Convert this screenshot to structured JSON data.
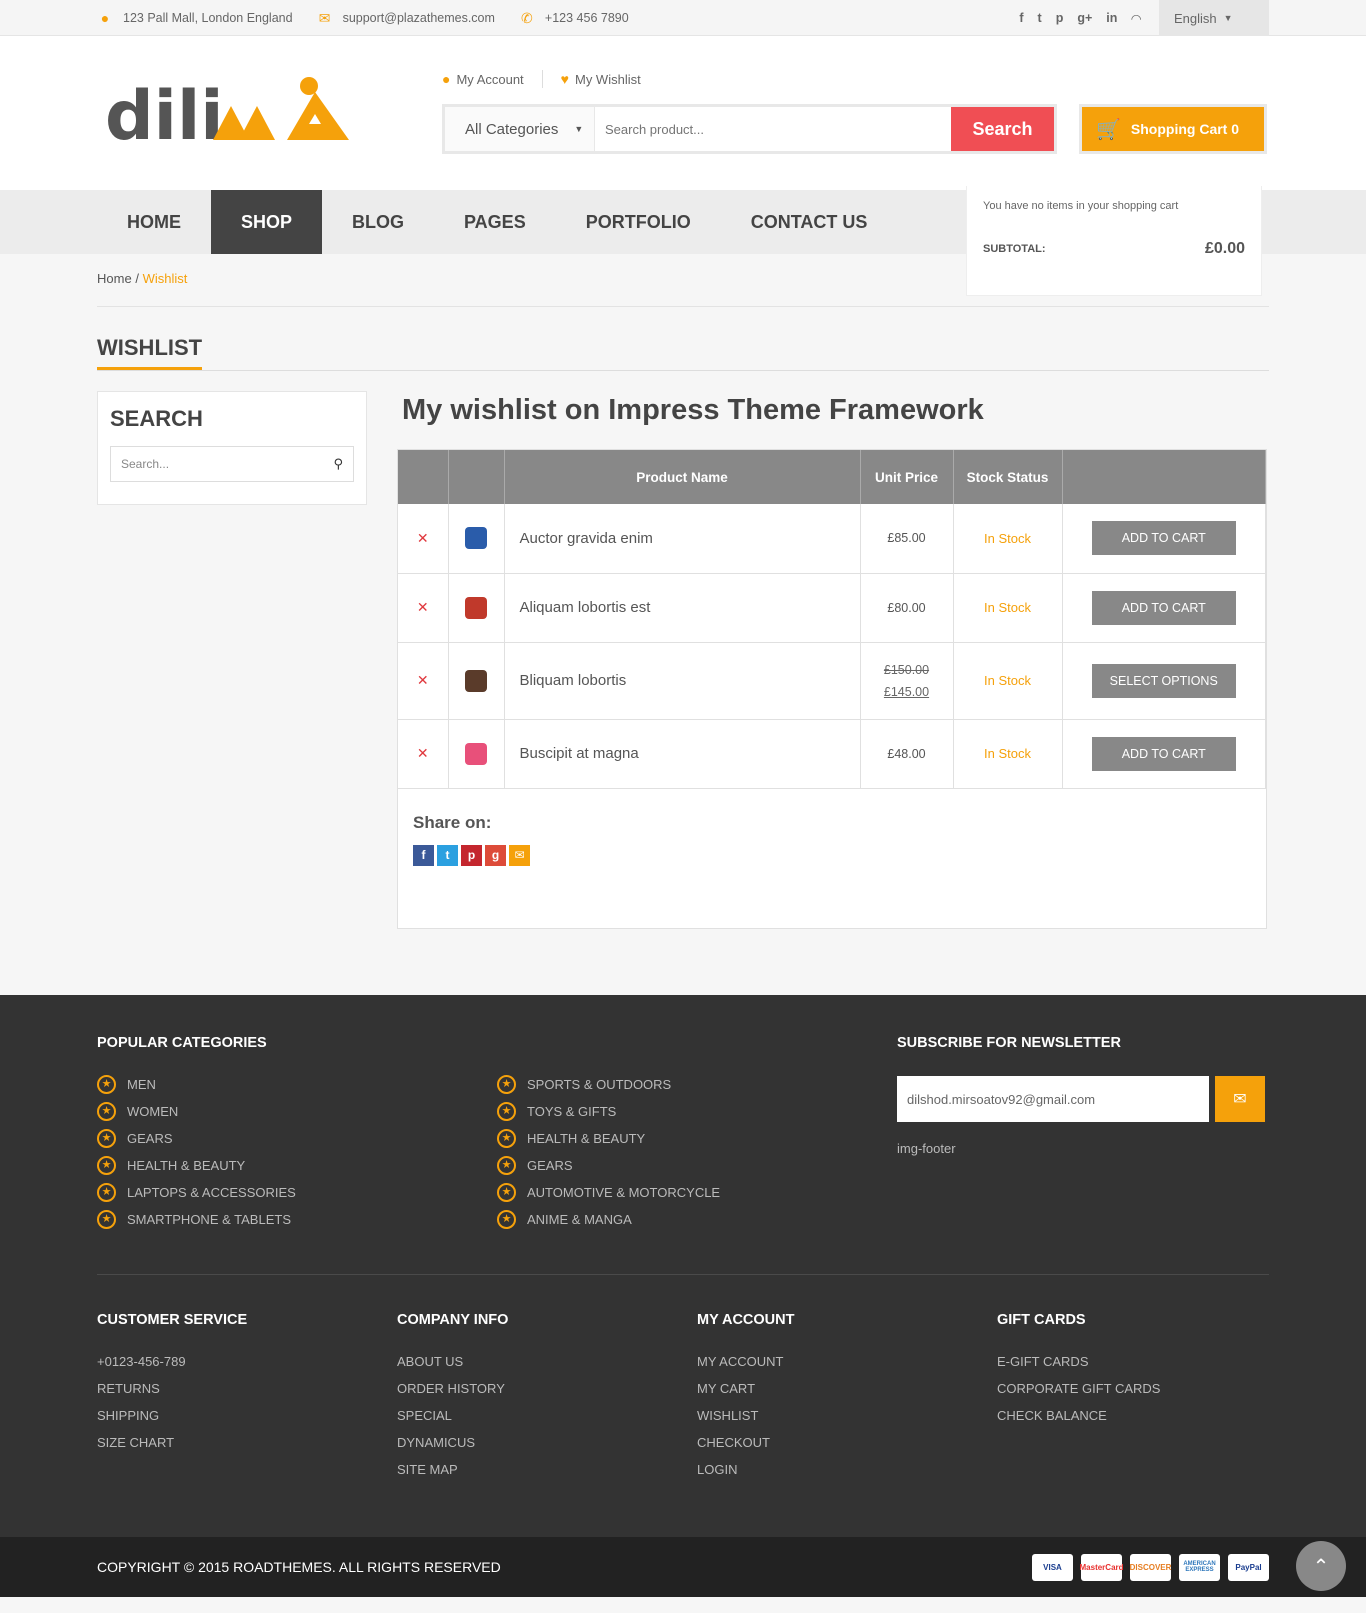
{
  "topbar": {
    "address": "123 Pall Mall, London England",
    "email": "support@plazathemes.com",
    "phone": "+123 456 7890",
    "language": "English"
  },
  "header": {
    "my_account": "My Account",
    "my_wishlist": "My Wishlist",
    "category_select": "All Categories",
    "search_placeholder": "Search product...",
    "search_button": "Search",
    "cart_label": "Shopping Cart 0",
    "cart_empty": "You have no items in your shopping cart",
    "subtotal_label": "SUBTOTAL:",
    "subtotal_value": "£0.00"
  },
  "nav": [
    "HOME",
    "SHOP",
    "BLOG",
    "PAGES",
    "PORTFOLIO",
    "CONTACT US"
  ],
  "breadcrumb": {
    "home": "Home",
    "sep": "/",
    "current": "Wishlist"
  },
  "page_title": "WISHLIST",
  "sidebar": {
    "title": "SEARCH",
    "placeholder": "Search..."
  },
  "wishlist": {
    "title": "My wishlist on Impress Theme Framework",
    "columns": {
      "name": "Product Name",
      "price": "Unit Price",
      "stock": "Stock Status"
    },
    "items": [
      {
        "name": "Auctor gravida enim",
        "price": "£85.00",
        "stock": "In Stock",
        "action": "ADD TO CART",
        "color": "#2a5caa"
      },
      {
        "name": "Aliquam lobortis est",
        "price": "£80.00",
        "stock": "In Stock",
        "action": "ADD TO CART",
        "color": "#c0392b"
      },
      {
        "name": "Bliquam lobortis",
        "old_price": "£150.00",
        "price": "£145.00",
        "stock": "In Stock",
        "action": "SELECT OPTIONS",
        "color": "#5a3b2a"
      },
      {
        "name": "Buscipit at magna",
        "price": "£48.00",
        "stock": "In Stock",
        "action": "ADD TO CART",
        "color": "#e8507a"
      }
    ],
    "share_label": "Share on:"
  },
  "footer": {
    "popular_title": "POPULAR CATEGORIES",
    "popular_col1": [
      "MEN",
      "WOMEN",
      "GEARS",
      "HEALTH & BEAUTY",
      "LAPTOPS & ACCESSORIES",
      "SMARTPHONE & TABLETS"
    ],
    "popular_col2": [
      "SPORTS & OUTDOORS",
      "TOYS & GIFTS",
      "HEALTH & BEAUTY",
      "GEARS",
      "AUTOMOTIVE & MOTORCYCLE",
      "ANIME & MANGA"
    ],
    "newsletter_title": "SUBSCRIBE FOR NEWSLETTER",
    "newsletter_value": "dilshod.mirsoatov92@gmail.com",
    "img_alt": "img-footer",
    "customer_service": {
      "title": "CUSTOMER SERVICE",
      "items": [
        "+0123-456-789",
        "RETURNS",
        "SHIPPING",
        "SIZE CHART"
      ]
    },
    "company_info": {
      "title": "COMPANY INFO",
      "items": [
        "ABOUT US",
        "ORDER HISTORY",
        "SPECIAL",
        "DYNAMICUS",
        "SITE MAP"
      ]
    },
    "my_account": {
      "title": "MY ACCOUNT",
      "items": [
        "MY ACCOUNT",
        "MY CART",
        "WISHLIST",
        "CHECKOUT",
        "LOGIN"
      ]
    },
    "gift_cards": {
      "title": "GIFT CARDS",
      "items": [
        "E-GIFT CARDS",
        "CORPORATE GIFT CARDS",
        "CHECK BALANCE"
      ]
    },
    "copyright": "COPYRIGHT © 2015 ROADTHEMES. ALL RIGHTS RESERVED",
    "payments": [
      "VISA",
      "MasterCard",
      "DISCOVER",
      "AMERICAN EXPRESS",
      "PayPal"
    ]
  },
  "colors": {
    "accent": "#f5a10b",
    "search": "#f04e54",
    "dark": "#333333"
  }
}
